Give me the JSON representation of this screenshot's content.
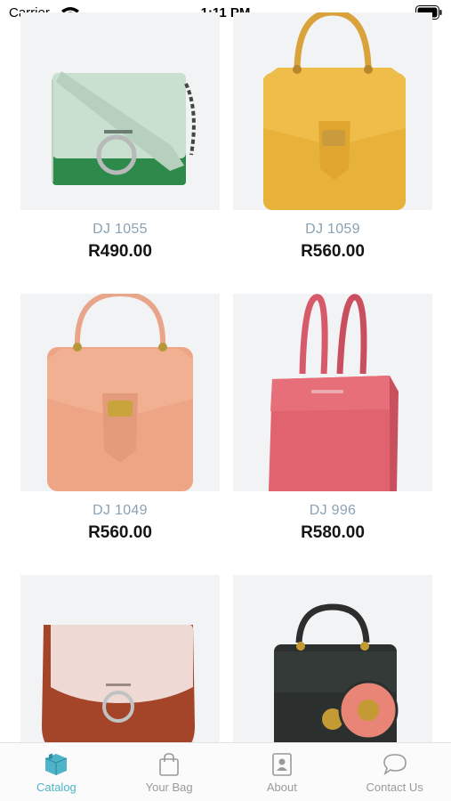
{
  "status_bar": {
    "carrier": "Carrier",
    "time": "1:11 PM",
    "wifi_icon": "wifi-icon",
    "battery_icon": "battery-icon"
  },
  "products": [
    {
      "code": "DJ 1055",
      "price": "R490.00",
      "image": "mint-green-crossbody-bag"
    },
    {
      "code": "DJ 1059",
      "price": "R560.00",
      "image": "mustard-yellow-backpack"
    },
    {
      "code": "DJ 1049",
      "price": "R560.00",
      "image": "peach-backpack"
    },
    {
      "code": "DJ 996",
      "price": "R580.00",
      "image": "pink-tote-bag"
    },
    {
      "code": "",
      "price": "",
      "image": "blush-brown-saddle-bag"
    },
    {
      "code": "",
      "price": "",
      "image": "black-top-handle-bag"
    }
  ],
  "tabs": [
    {
      "label": "Catalog",
      "icon": "catalog-box-icon",
      "active": true
    },
    {
      "label": "Your Bag",
      "icon": "shopping-bag-icon",
      "active": false
    },
    {
      "label": "About",
      "icon": "contact-card-icon",
      "active": false
    },
    {
      "label": "Contact Us",
      "icon": "chat-bubble-icon",
      "active": false
    }
  ],
  "colors": {
    "accent": "#4fb4c7",
    "inactive_tab": "#9a9a9a",
    "product_code": "#8aa2b3",
    "thumb_background": "#f1f3f5"
  }
}
